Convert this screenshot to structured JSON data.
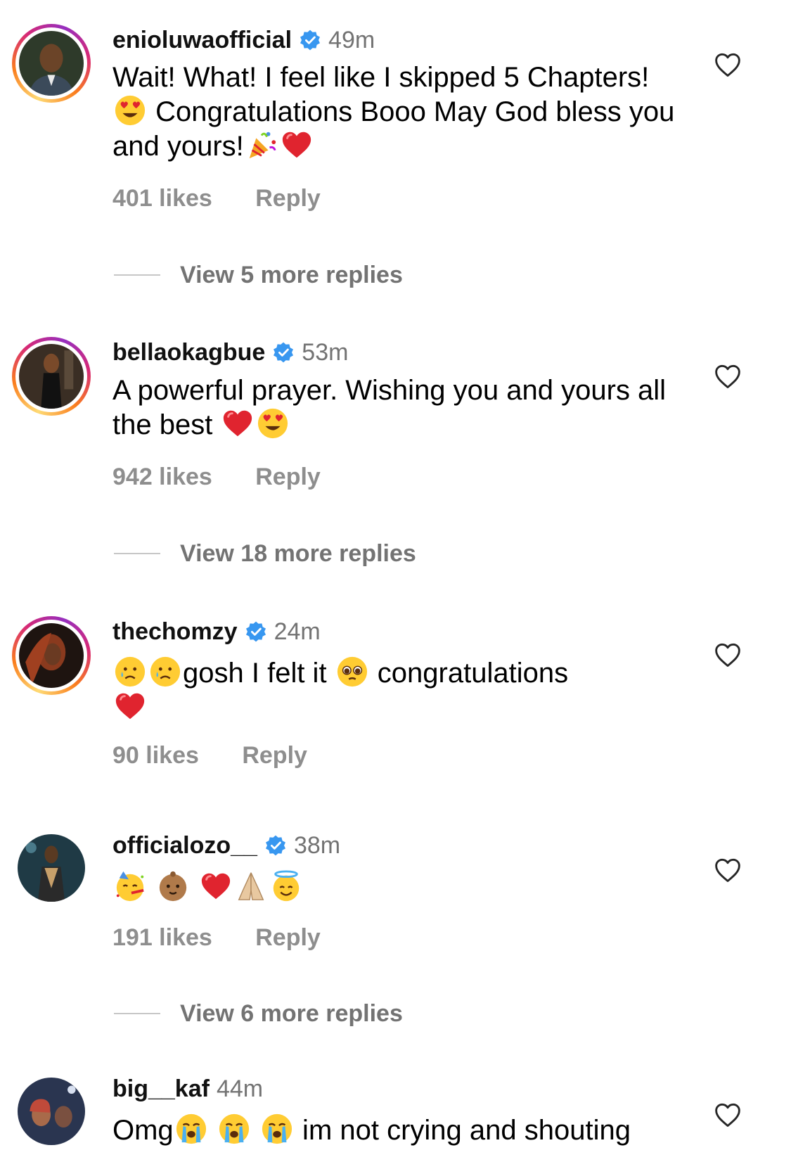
{
  "comments": [
    {
      "username": "enioluwaofficial",
      "verified": true,
      "time": "49m",
      "text_parts": [
        "Wait! What! I feel like I skipped 5 Chapters!",
        " Congratulations Booo May God bless you and yours!"
      ],
      "likes": "401 likes",
      "reply": "Reply",
      "more_replies": "View 5 more replies"
    },
    {
      "username": "bellaokagbue",
      "verified": true,
      "time": "53m",
      "text_parts": [
        "A powerful prayer. Wishing you and yours all the best "
      ],
      "likes": "942 likes",
      "reply": "Reply",
      "more_replies": "View 18 more replies"
    },
    {
      "username": "thechomzy",
      "verified": true,
      "time": "24m",
      "text_parts": [
        "gosh I felt it ",
        " congratulations"
      ],
      "likes": "90 likes",
      "reply": "Reply",
      "more_replies": ""
    },
    {
      "username": "officialozo__",
      "verified": true,
      "time": "38m",
      "text_parts": [],
      "likes": "191 likes",
      "reply": "Reply",
      "more_replies": "View 6 more replies"
    },
    {
      "username": "big__kaf",
      "verified": false,
      "time": "44m",
      "text_parts": [
        "Omg",
        " im not crying and shouting"
      ],
      "likes": "",
      "reply": "",
      "more_replies": ""
    }
  ],
  "icons": {
    "like": "heart-outline-icon",
    "verified": "verified-badge-icon"
  },
  "colors": {
    "verified": "#3897f0",
    "secondary_text": "#737373",
    "action_text": "#8e8e8e"
  }
}
